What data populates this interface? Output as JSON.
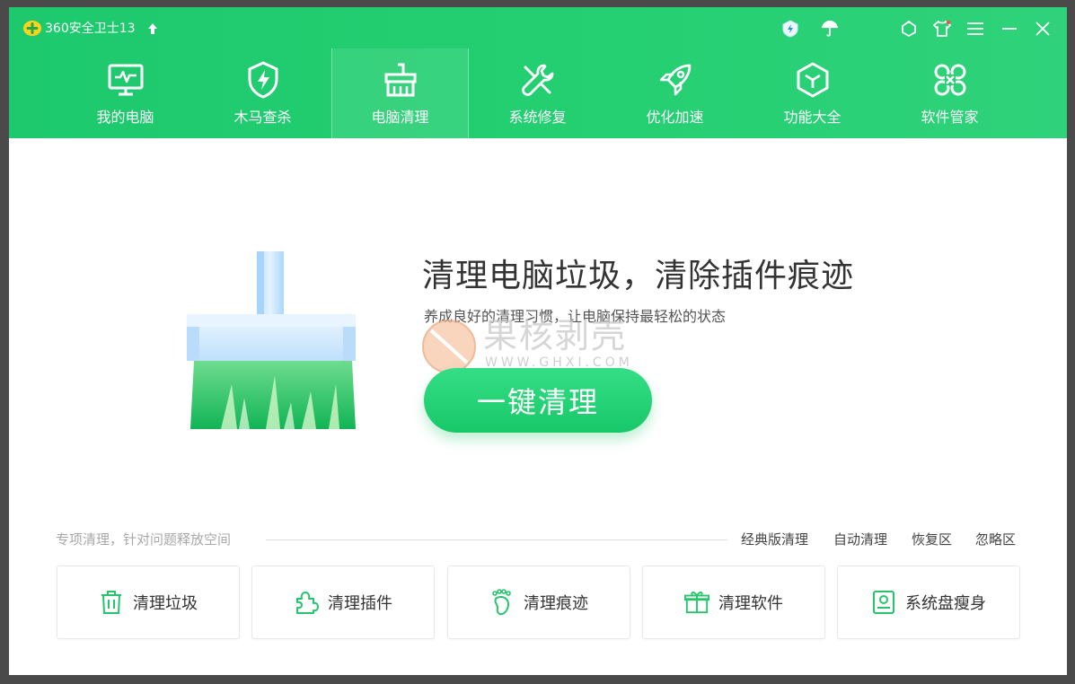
{
  "app": {
    "title": "360安全卫士13",
    "brand_color": "#22cc70"
  },
  "titlebar": {
    "icons": [
      "shield-lightning-icon",
      "umbrella-icon",
      "bell-icon",
      "shirt-icon",
      "menu-icon",
      "minimize-icon",
      "close-icon"
    ]
  },
  "nav": {
    "items": [
      {
        "label": "我的电脑",
        "icon": "monitor-icon"
      },
      {
        "label": "木马查杀",
        "icon": "shield-lightning-icon"
      },
      {
        "label": "电脑清理",
        "icon": "broom-icon",
        "active": true
      },
      {
        "label": "系统修复",
        "icon": "wrench-icon"
      },
      {
        "label": "优化加速",
        "icon": "rocket-icon"
      },
      {
        "label": "功能大全",
        "icon": "cube-icon"
      },
      {
        "label": "软件管家",
        "icon": "apps-icon"
      }
    ]
  },
  "hero": {
    "title": "清理电脑垃圾，清除插件痕迹",
    "subtitle": "养成良好的清理习惯，让电脑保持最轻松的状态",
    "button_label": "一键清理"
  },
  "watermark": {
    "text": "果核剥壳",
    "url": "WWW.GHXI.COM"
  },
  "special": {
    "label": "专项清理，针对问题释放空间",
    "links": [
      "经典版清理",
      "自动清理",
      "恢复区",
      "忽略区"
    ],
    "tools": [
      {
        "label": "清理垃圾",
        "icon": "trash-icon"
      },
      {
        "label": "清理插件",
        "icon": "puzzle-icon"
      },
      {
        "label": "清理痕迹",
        "icon": "footprint-icon"
      },
      {
        "label": "清理软件",
        "icon": "package-icon"
      },
      {
        "label": "系统盘瘦身",
        "icon": "disk-icon"
      }
    ]
  }
}
